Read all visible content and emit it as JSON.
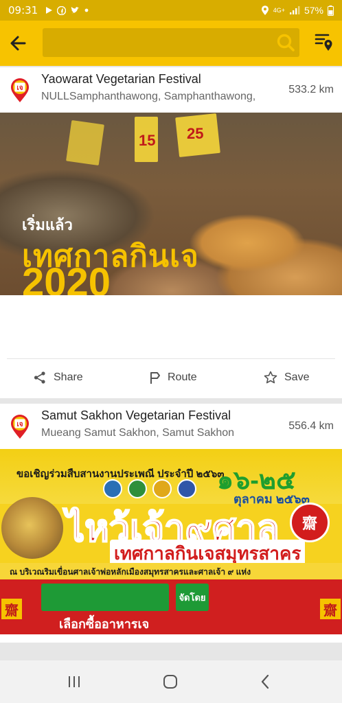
{
  "status_bar": {
    "time": "09:31",
    "network": "4G+",
    "battery": "57%",
    "icons": [
      "play-icon",
      "facebook-icon",
      "twitter-icon",
      "dot-icon",
      "location-icon",
      "signal-icon",
      "battery-icon"
    ]
  },
  "toolbar": {
    "back_icon": "arrow-left-icon",
    "search_value": "",
    "search_icon": "search-icon",
    "map_list_icon": "map-list-icon",
    "colors": {
      "bar": "#f7c300",
      "search_field": "#d8ac00"
    }
  },
  "results": [
    {
      "title": "Yaowarat Vegetarian Festival",
      "subtitle": "NULLSamphanthawong, Samphanthawong,",
      "distance": "533.2 km",
      "pin_glyph": "เจ",
      "image": {
        "line1": "เริ่มแล้ว",
        "line2": "เทศกาลกินเจ",
        "year": "2020",
        "tag1": "15",
        "tag2": "25"
      }
    },
    {
      "title": "Samut Sakhon Vegetarian Festival",
      "subtitle": "Mueang Samut Sakhon, Samut Sakhon",
      "distance": "556.4 km",
      "pin_glyph": "เจ",
      "image": {
        "invite": "ขอเชิญร่วมสืบสานงานประเพณี ประจำปี ๒๕๖๓",
        "dates": "๑๖-๒๕",
        "month": "ตุลาคม ๒๕๖๓",
        "headline": "ไหว้เจ้า๙ศาล",
        "subheadline": "เทศกาลกินเจสมุทรสาคร",
        "badge": "齋",
        "venue": "ณ บริเวณริมเขื่อนศาลเจ้าพ่อหลักเมืองสมุทรสาครและศาลเจ้า ๙ แห่ง",
        "organizer": "จัดโดย",
        "buy": "เลือกซื้ออาหารเจ"
      }
    }
  ],
  "actions": {
    "share": "Share",
    "route": "Route",
    "save": "Save"
  },
  "nav": {
    "recents_icon": "recent-apps-icon",
    "home_icon": "home-icon",
    "back_icon": "back-icon"
  }
}
